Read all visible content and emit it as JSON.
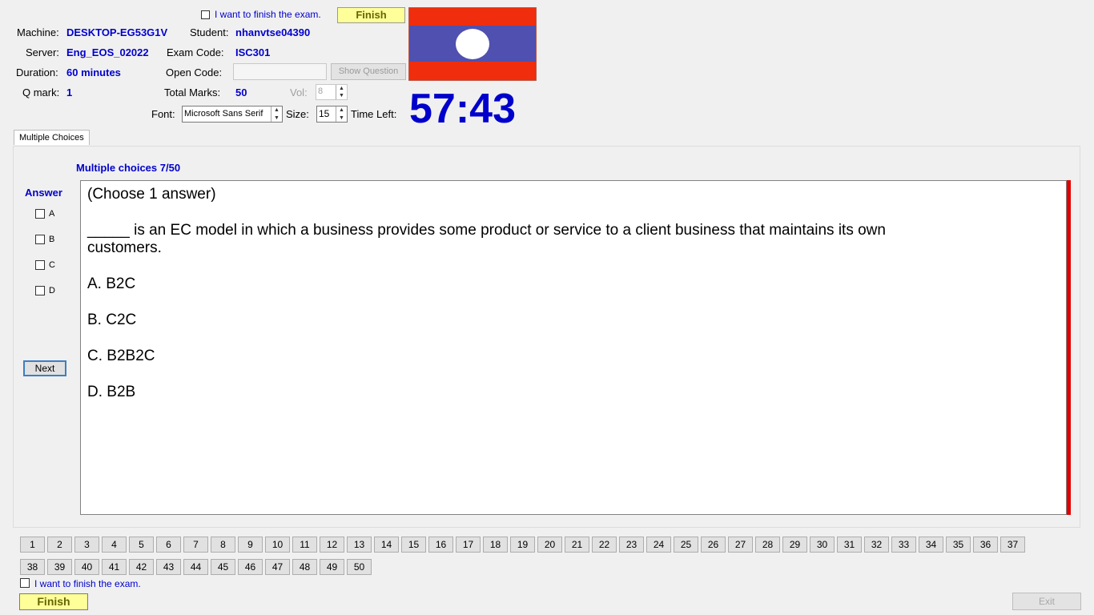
{
  "header": {
    "finish_check_label": "I want to finish the exam.",
    "finish_label": "Finish",
    "machine_label": "Machine:",
    "machine_value": "DESKTOP-EG53G1V",
    "student_label": "Student:",
    "student_value": "nhanvtse04390",
    "server_label": "Server:",
    "server_value": "Eng_EOS_02022",
    "exam_code_label": "Exam Code:",
    "exam_code_value": "ISC301",
    "duration_label": "Duration:",
    "duration_value": "60 minutes",
    "open_code_label": "Open Code:",
    "open_code_value": "",
    "show_question_label": "Show Question",
    "qmark_label": "Q mark:",
    "qmark_value": "1",
    "total_marks_label": "Total Marks:",
    "total_marks_value": "50",
    "vol_label": "Vol:",
    "vol_value": "8",
    "font_label": "Font:",
    "font_value": "Microsoft Sans Serif",
    "size_label": "Size:",
    "size_value": "15",
    "time_left_label": "Time Left:",
    "timer": "57:43"
  },
  "colors": {
    "flag_red": "#f02d0c",
    "flag_blue": "#5050b0",
    "accent_blue": "#0000cc"
  },
  "tab": {
    "label": "Multiple Choices"
  },
  "question": {
    "counter": "Multiple choices 7/50",
    "answer_label": "Answer",
    "options": [
      "A",
      "B",
      "C",
      "D"
    ],
    "next_label": "Next",
    "instruction": "(Choose 1 answer)",
    "text": "_____ is an EC model in which a business provides some product or service to a client business that maintains its own customers.",
    "choices": [
      "A.  B2C",
      "B.  C2C",
      "C.  B2B2C",
      "D.  B2B"
    ]
  },
  "question_numbers": [
    "1",
    "2",
    "3",
    "4",
    "5",
    "6",
    "7",
    "8",
    "9",
    "10",
    "11",
    "12",
    "13",
    "14",
    "15",
    "16",
    "17",
    "18",
    "19",
    "20",
    "21",
    "22",
    "23",
    "24",
    "25",
    "26",
    "27",
    "28",
    "29",
    "30",
    "31",
    "32",
    "33",
    "34",
    "35",
    "36",
    "37",
    "38",
    "39",
    "40",
    "41",
    "42",
    "43",
    "44",
    "45",
    "46",
    "47",
    "48",
    "49",
    "50"
  ],
  "footer": {
    "finish_check_label": "I want to finish the exam.",
    "finish_label": "Finish",
    "exit_label": "Exit"
  }
}
